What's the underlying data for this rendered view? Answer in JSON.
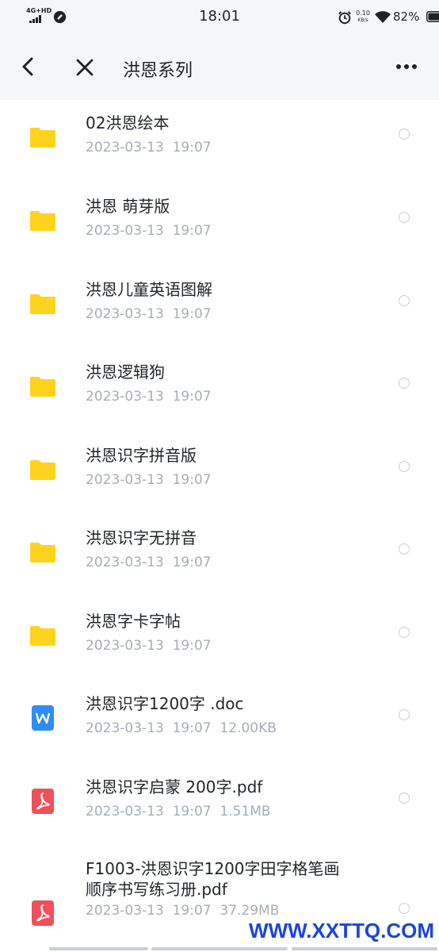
{
  "status_bar": {
    "network": "4G+HD",
    "time": "18:01",
    "speed_value": "0.10",
    "speed_unit": "KB/s",
    "battery_percent": "82%",
    "battery_level": 0.82
  },
  "header": {
    "title": "洪恩系列",
    "back_icon": "chevron-left-icon",
    "close_icon": "close-icon",
    "more_icon": "more-icon"
  },
  "files": [
    {
      "name": "02洪恩绘本",
      "meta": "2023-03-13  19:07",
      "type": "folder"
    },
    {
      "name": "洪恩  萌芽版",
      "meta": "2023-03-13  19:07",
      "type": "folder"
    },
    {
      "name": "洪恩儿童英语图解",
      "meta": "2023-03-13  19:07",
      "type": "folder"
    },
    {
      "name": "洪恩逻辑狗",
      "meta": "2023-03-13  19:07",
      "type": "folder"
    },
    {
      "name": "洪恩识字拼音版",
      "meta": "2023-03-13  19:07",
      "type": "folder"
    },
    {
      "name": "洪恩识字无拼音",
      "meta": "2023-03-13  19:07",
      "type": "folder"
    },
    {
      "name": "洪恩字卡字帖",
      "meta": "2023-03-13  19:07",
      "type": "folder"
    },
    {
      "name": "洪恩识字1200字 .doc",
      "meta": "2023-03-13  19:07  12.00KB",
      "type": "word"
    },
    {
      "name": "洪恩识字启蒙 200字.pdf",
      "meta": "2023-03-13  19:07  1.51MB",
      "type": "pdf"
    },
    {
      "name": "F1003-洪恩识字1200字田字格笔画",
      "name2": "顺序书写练习册.pdf",
      "meta": "2023-03-13  19:07  37.29MB",
      "type": "pdf"
    }
  ],
  "watermark": "WWW.XXTTQ.COM",
  "colors": {
    "folder": "#FFD21E",
    "word": "#2E8DF5",
    "pdf": "#F0505A",
    "meta_text": "#A7ADB8",
    "watermark": "#1A44E0"
  }
}
